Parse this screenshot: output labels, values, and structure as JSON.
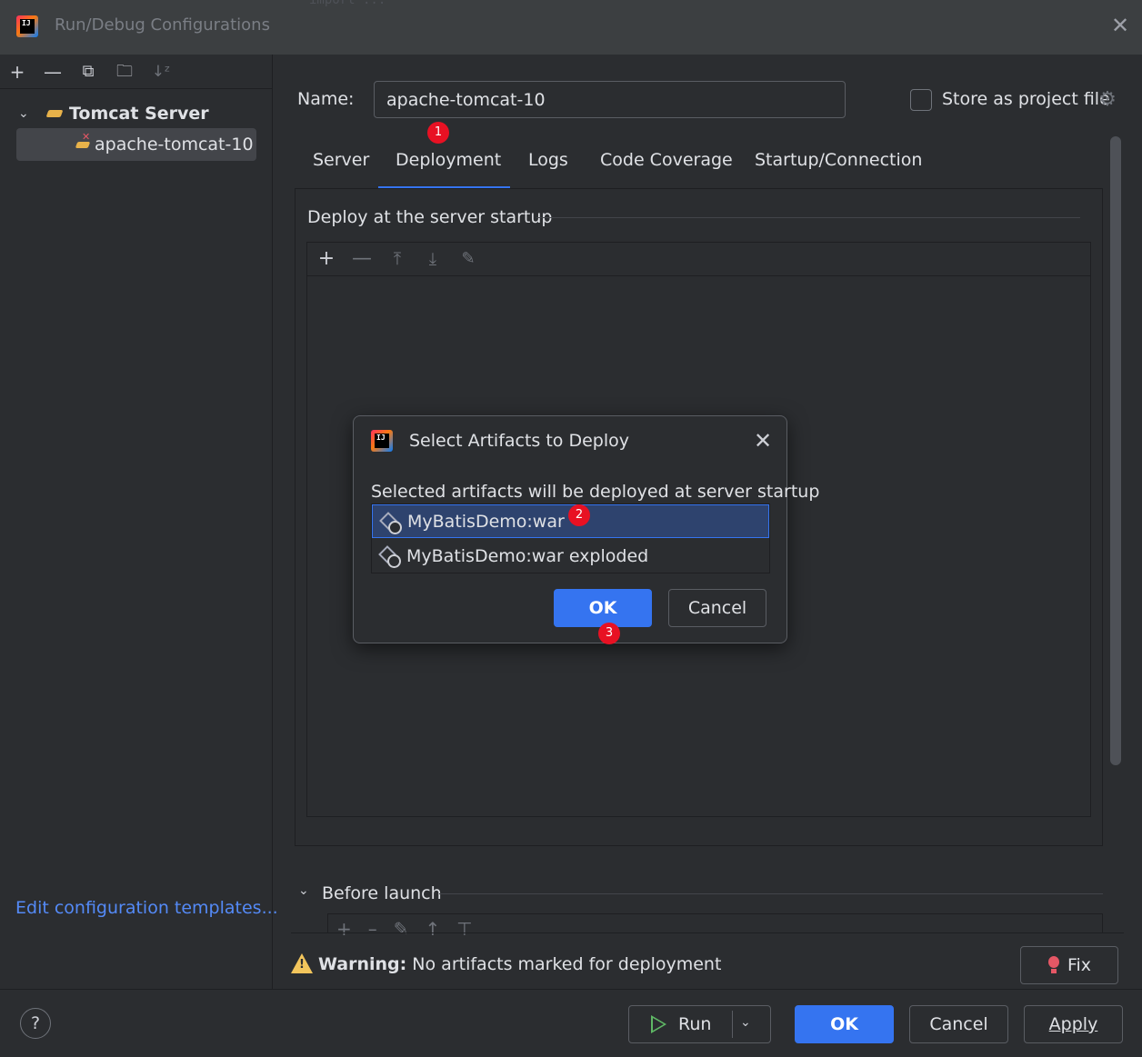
{
  "window": {
    "title": "Run/Debug Configurations",
    "app_icon_text": "IJ",
    "background_code": "import ..."
  },
  "sidebar": {
    "toolbar": [
      "add",
      "remove",
      "copy",
      "new-folder",
      "sort"
    ],
    "group_label": "Tomcat Server",
    "item_label": "apache-tomcat-10",
    "edit_templates": "Edit configuration templates..."
  },
  "form": {
    "name_label": "Name:",
    "name_value": "apache-tomcat-10",
    "store_label": "Store as project file",
    "store_checked": false
  },
  "tabs": [
    "Server",
    "Deployment",
    "Logs",
    "Code Coverage",
    "Startup/Connection"
  ],
  "active_tab": "Deployment",
  "deployment": {
    "section_title": "Deploy at the server startup"
  },
  "before_launch": {
    "label": "Before launch"
  },
  "warning": {
    "bold": "Warning:",
    "text": "No artifacts marked for deployment",
    "fix_label": "Fix"
  },
  "footer": {
    "help": "?",
    "run": "Run",
    "ok": "OK",
    "cancel": "Cancel",
    "apply": "Apply"
  },
  "dialog": {
    "title": "Select Artifacts to Deploy",
    "description": "Selected artifacts will be deployed at server startup",
    "items": [
      "MyBatisDemo:war",
      "MyBatisDemo:war exploded"
    ],
    "selected_index": 0,
    "ok": "OK",
    "cancel": "Cancel"
  },
  "badges": [
    "1",
    "2",
    "3"
  ],
  "colors": {
    "accent": "#3574f0",
    "link": "#548af7",
    "badge": "#e81123",
    "warning": "#f2c55c",
    "selection": "#2e436e"
  }
}
